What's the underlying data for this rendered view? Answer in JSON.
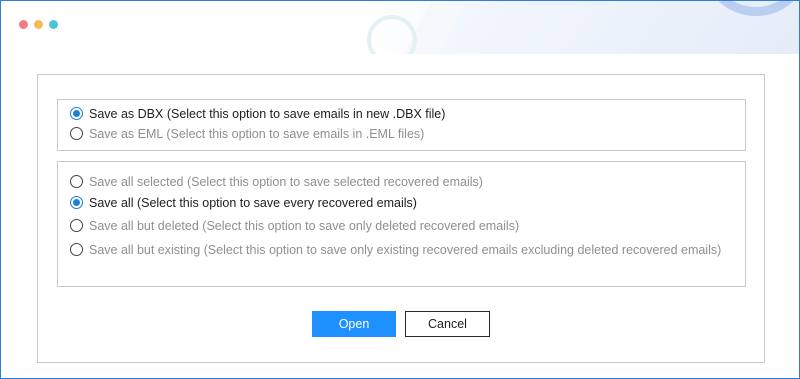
{
  "window": {
    "controls": [
      "close",
      "minimize",
      "maximize"
    ]
  },
  "format_group": {
    "options": [
      {
        "label": "Save as DBX (Select this option to save emails in new .DBX file)",
        "checked": true
      },
      {
        "label": "Save as EML (Select this option to save emails in .EML files)",
        "checked": false
      }
    ]
  },
  "scope_group": {
    "options": [
      {
        "label": "Save all selected (Select this option to save selected recovered emails)",
        "checked": false
      },
      {
        "label": "Save all (Select this option to save every recovered emails)",
        "checked": true
      },
      {
        "label": "Save all but deleted (Select this option to save only deleted recovered emails)",
        "checked": false
      },
      {
        "label": "Save all but existing (Select this option to save only existing recovered emails excluding deleted recovered emails)",
        "checked": false
      }
    ]
  },
  "buttons": {
    "open_label": "Open",
    "cancel_label": "Cancel"
  },
  "colors": {
    "accent": "#1e90ff",
    "window_border": "#2f7fd6",
    "dot_red": "#f07b84",
    "dot_yellow": "#f5bc56",
    "dot_teal": "#4fc3d6"
  }
}
